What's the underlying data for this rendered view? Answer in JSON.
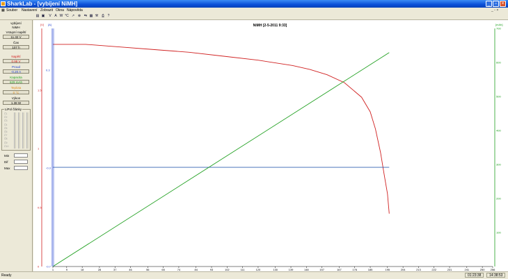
{
  "window": {
    "title": "SharkLab - [vybíjení NiMH]",
    "menu": [
      "Soubor",
      "Nastavení",
      "Zobrazit",
      "Okna",
      "Nápověda"
    ],
    "mdi_controls": "_ ▫ ×"
  },
  "toolbar": {
    "icons": [
      "save-icon",
      "floppy-icon",
      "voltage-icon",
      "current-icon",
      "power-icon",
      "temperature-icon",
      "curve-icon",
      "stop-icon",
      "connect-icon",
      "table-icon",
      "settings-icon",
      "print-icon",
      "help-icon"
    ],
    "glyphs": [
      "▤",
      "▣",
      "V",
      "A",
      "W",
      "°C",
      "↗",
      "⊗",
      "⇆",
      "▦",
      "⚒",
      "⎙",
      "?"
    ]
  },
  "sidebar": {
    "status_label": "vybíjení",
    "status_value": "NiMH",
    "voltage_in_label": "Vstupní napětí",
    "voltage_in_value": "11.32 V",
    "time_label": "Čas",
    "time_value": "107 h",
    "voltage_label": "Napětí",
    "voltage_value": "0.98 V",
    "current_label": "Proud",
    "current_value": "-0.20 A",
    "capacity_label": "Kapacita",
    "capacity_value": "629 mAh",
    "temp_label": "Teplota",
    "temp_value": "0 °C",
    "power_label": "Výkon",
    "power_value": "1.38 W",
    "cells_label": "LiPol články",
    "cells": [
      "Č1",
      "Č2",
      "Č3",
      "Č4",
      "Č5",
      "Č6",
      "Č7",
      "Č8",
      "Č9",
      "Č10"
    ],
    "min_label": "Min",
    "diff_label": "Dif",
    "max_label": "Max",
    "colors": {
      "voltage": "#d02020",
      "current": "#2040d0",
      "capacity": "#20a020",
      "temperature": "#e09020"
    }
  },
  "chart_data": {
    "type": "line",
    "title": "NiMH [2-5-2011 9:33]",
    "left_axis_1": {
      "label": "[V]",
      "ticks": [
        "1.5",
        "1",
        "0.5",
        "0"
      ],
      "color": "#d02020"
    },
    "left_axis_2": {
      "label": "[A]",
      "ticks": [
        "0.3",
        "-0.3",
        "-0.7"
      ],
      "color": "#2040d0"
    },
    "right_axis": {
      "label": "[mAh]",
      "range": [
        0,
        700
      ],
      "ticks": [
        "700",
        "600",
        "500",
        "400",
        "300",
        "200",
        "100"
      ],
      "color": "#20a020"
    },
    "x_range": [
      1,
      256
    ],
    "x_ticks": [
      "1",
      "9",
      "18",
      "28",
      "37",
      "46",
      "56",
      "65",
      "74",
      "84",
      "93",
      "102",
      "111",
      "120",
      "130",
      "139",
      "148",
      "157",
      "167",
      "176",
      "185",
      "195",
      "204",
      "213",
      "222",
      "231",
      "241",
      "250",
      "256"
    ],
    "series": [
      {
        "name": "Napětí",
        "color": "#d02020",
        "y_range": [
          0,
          1.8
        ],
        "x": [
          1,
          20,
          40,
          60,
          80,
          100,
          120,
          140,
          150,
          160,
          170,
          180,
          185,
          188,
          191,
          193,
          195,
          196
        ],
        "y": [
          1.68,
          1.68,
          1.66,
          1.64,
          1.62,
          1.59,
          1.56,
          1.52,
          1.49,
          1.45,
          1.39,
          1.28,
          1.17,
          1.04,
          0.86,
          0.7,
          0.55,
          0.4
        ]
      },
      {
        "name": "Proud",
        "color": "#3060b0",
        "y_range": [
          -0.7,
          0.5
        ],
        "x": [
          1,
          196
        ],
        "y": [
          -0.2,
          -0.2
        ]
      },
      {
        "name": "Kapacita",
        "color": "#20a020",
        "y_range": [
          0,
          700
        ],
        "x": [
          1,
          196
        ],
        "y": [
          0,
          629
        ]
      }
    ]
  },
  "statusbar": {
    "state": "Ready",
    "elapsed": "01:23:38",
    "clock": "14:38:53"
  }
}
